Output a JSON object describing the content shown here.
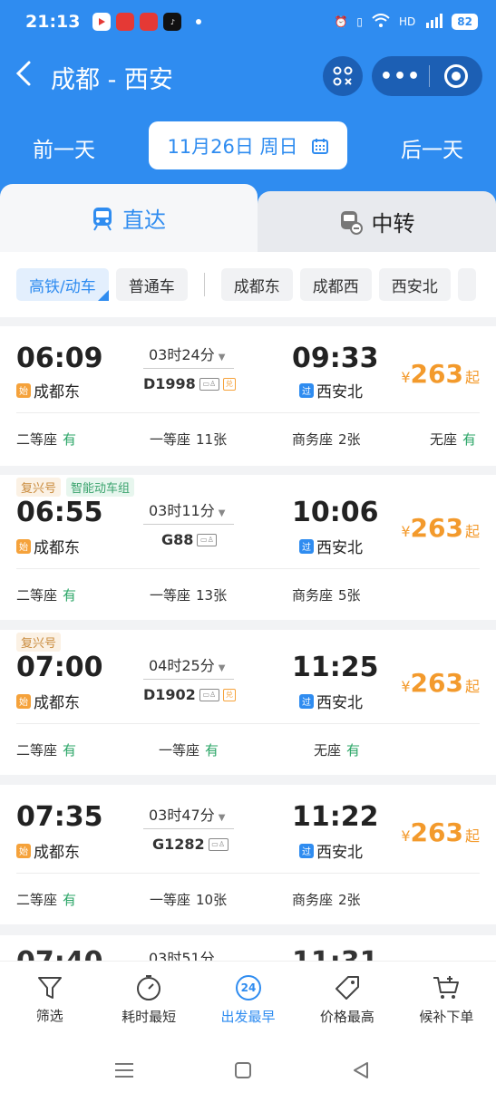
{
  "status": {
    "time": "21:13",
    "battery": "82"
  },
  "header": {
    "title": "成都 - 西安",
    "prev_day": "前一天",
    "next_day": "后一天",
    "date": "11月26日 周日"
  },
  "tabs": {
    "direct": "直达",
    "transfer": "中转"
  },
  "filters": [
    "高铁/动车",
    "普通车",
    "成都东",
    "成都西",
    "西安北"
  ],
  "trains": [
    {
      "tags": [],
      "dep_time": "06:09",
      "dep_station": "成都东",
      "dep_badge": "始",
      "duration": "03时24分",
      "train_no": "D1998",
      "arr_time": "09:33",
      "arr_station": "西安北",
      "arr_badge": "过",
      "price_symbol": "¥",
      "price": "263",
      "price_suffix": "起",
      "seats": [
        {
          "name": "二等座",
          "status": "有"
        },
        {
          "name": "一等座",
          "status": "11张"
        },
        {
          "name": "商务座",
          "status": "2张"
        },
        {
          "name": "无座",
          "status": "有"
        }
      ]
    },
    {
      "tags": [
        "复兴号",
        "智能动车组"
      ],
      "dep_time": "06:55",
      "dep_station": "成都东",
      "dep_badge": "始",
      "duration": "03时11分",
      "train_no": "G88",
      "arr_time": "10:06",
      "arr_station": "西安北",
      "arr_badge": "过",
      "price_symbol": "¥",
      "price": "263",
      "price_suffix": "起",
      "seats": [
        {
          "name": "二等座",
          "status": "有"
        },
        {
          "name": "一等座",
          "status": "13张"
        },
        {
          "name": "商务座",
          "status": "5张"
        }
      ]
    },
    {
      "tags": [
        "复兴号"
      ],
      "dep_time": "07:00",
      "dep_station": "成都东",
      "dep_badge": "始",
      "duration": "04时25分",
      "train_no": "D1902",
      "arr_time": "11:25",
      "arr_station": "西安北",
      "arr_badge": "过",
      "price_symbol": "¥",
      "price": "263",
      "price_suffix": "起",
      "seats": [
        {
          "name": "二等座",
          "status": "有"
        },
        {
          "name": "一等座",
          "status": "有"
        },
        {
          "name": "无座",
          "status": "有"
        }
      ]
    },
    {
      "tags": [],
      "dep_time": "07:35",
      "dep_station": "成都东",
      "dep_badge": "始",
      "duration": "03时47分",
      "train_no": "G1282",
      "arr_time": "11:22",
      "arr_station": "西安北",
      "arr_badge": "过",
      "price_symbol": "¥",
      "price": "263",
      "price_suffix": "起",
      "seats": [
        {
          "name": "二等座",
          "status": "有"
        },
        {
          "name": "一等座",
          "status": "10张"
        },
        {
          "name": "商务座",
          "status": "2张"
        }
      ]
    }
  ],
  "peek": {
    "dep_time": "07:40",
    "duration": "03时51分",
    "arr_time": "11:31"
  },
  "toolbar": [
    {
      "label": "筛选",
      "icon": "filter-icon"
    },
    {
      "label": "耗时最短",
      "icon": "timer-icon"
    },
    {
      "label": "出发最早",
      "icon": "clock-24-icon",
      "badge": "24"
    },
    {
      "label": "价格最高",
      "icon": "price-tag-icon"
    },
    {
      "label": "候补下单",
      "icon": "cart-add-icon"
    }
  ],
  "colors": {
    "brand_blue": "#2f8cf0",
    "price_orange": "#f39a2c",
    "available_green": "#2aa566"
  }
}
